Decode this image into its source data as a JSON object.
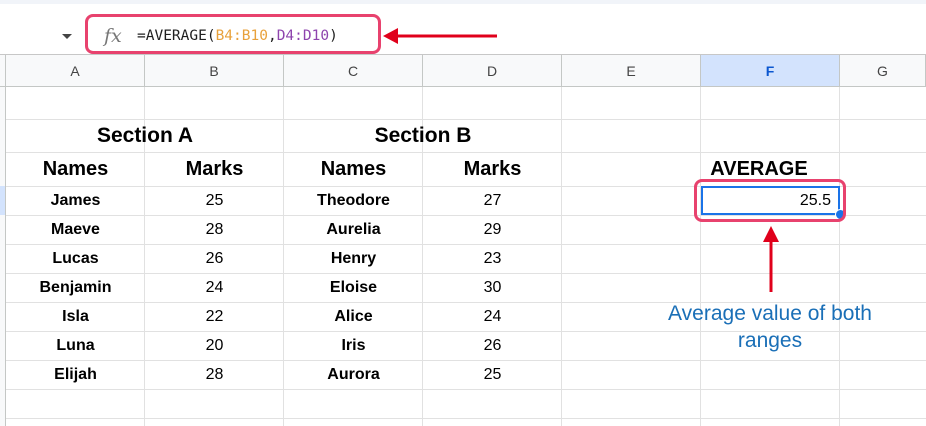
{
  "formula_bar": {
    "fx_label": "fx",
    "formula_parts": [
      {
        "text": "=AVERAGE(",
        "color": "#1f1f1f"
      },
      {
        "text": "B4:B10",
        "color": "#e8a13b"
      },
      {
        "text": ",",
        "color": "#1f1f1f"
      },
      {
        "text": "D4:D10",
        "color": "#8e44ad"
      },
      {
        "text": ")",
        "color": "#1f1f1f"
      }
    ]
  },
  "columns": [
    "A",
    "B",
    "C",
    "D",
    "E",
    "F",
    "G"
  ],
  "selected_column": "F",
  "sheet": {
    "section_a_title": "Section A",
    "section_b_title": "Section B",
    "headers": {
      "a_names": "Names",
      "a_marks": "Marks",
      "b_names": "Names",
      "b_marks": "Marks"
    },
    "rows": [
      {
        "a_name": "James",
        "a_mark": "25",
        "b_name": "Theodore",
        "b_mark": "27"
      },
      {
        "a_name": "Maeve",
        "a_mark": "28",
        "b_name": "Aurelia",
        "b_mark": "29"
      },
      {
        "a_name": "Lucas",
        "a_mark": "26",
        "b_name": "Henry",
        "b_mark": "23"
      },
      {
        "a_name": "Benjamin",
        "a_mark": "24",
        "b_name": "Eloise",
        "b_mark": "30"
      },
      {
        "a_name": "Isla",
        "a_mark": "22",
        "b_name": "Alice",
        "b_mark": "24"
      },
      {
        "a_name": "Luna",
        "a_mark": "20",
        "b_name": "Iris",
        "b_mark": "26"
      },
      {
        "a_name": "Elijah",
        "a_mark": "28",
        "b_name": "Aurora",
        "b_mark": "25"
      }
    ],
    "average_label": "AVERAGE",
    "average_value": "25.5"
  },
  "annotation": "Average value of both\nranges",
  "colors": {
    "highlight": "#e8426e",
    "arrow": "#e0001b",
    "selection": "#1a73e8",
    "annotation": "#1a6fb7"
  }
}
